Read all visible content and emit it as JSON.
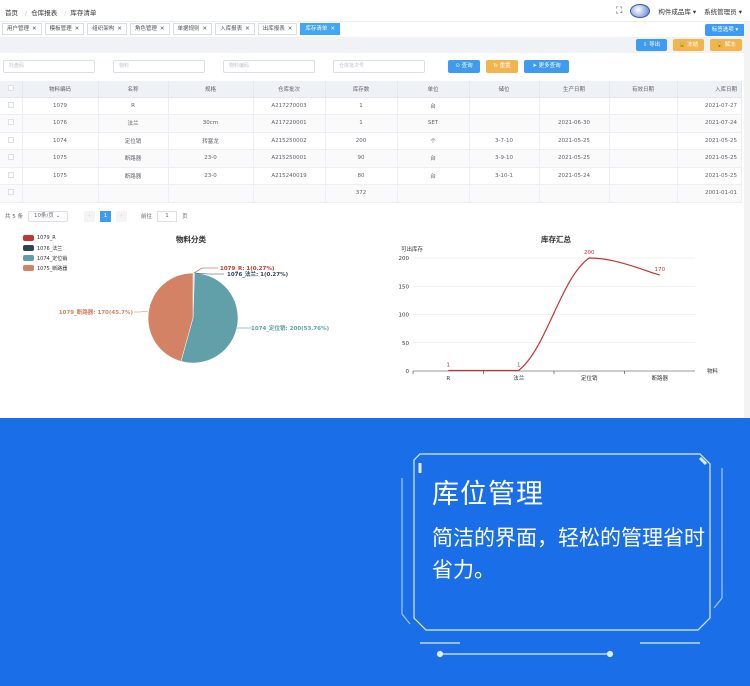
{
  "breadcrumb": [
    "首页",
    "仓库报表",
    "库存清单"
  ],
  "header": {
    "company": "构件成品库 ▾",
    "user": "系统管理员 ▾"
  },
  "tabs": [
    {
      "label": "用户管理"
    },
    {
      "label": "模板管理"
    },
    {
      "label": "组织架构"
    },
    {
      "label": "角色管理"
    },
    {
      "label": "单据规则"
    },
    {
      "label": "入库报表"
    },
    {
      "label": "出库报表"
    },
    {
      "label": "库存清单"
    }
  ],
  "actions": {
    "switch_label": "标签选项 ▾",
    "export_label": "导出",
    "freeze_label": "冻结",
    "unfreeze_label": "解冻"
  },
  "filters": {
    "p1": "托盘码",
    "p2": "物料",
    "p3": "物料编码",
    "p4": "仓库批次号"
  },
  "filter_buttons": {
    "search": "查询",
    "reset": "重置",
    "more": "更多查询"
  },
  "table": {
    "columns": [
      "物料编码",
      "名称",
      "规格",
      "仓库批次",
      "库存数",
      "单位",
      "储位",
      "生产日期",
      "有效日期",
      "入库日期"
    ],
    "rows": [
      [
        "1079",
        "R",
        "",
        "A217270003",
        "1",
        "台",
        "",
        "",
        "",
        "2021-07-27"
      ],
      [
        "1076",
        "法兰",
        "30cm",
        "A217220001",
        "1",
        "SET",
        "",
        "2021-06-30",
        "",
        "2021-07-24"
      ],
      [
        "1074",
        "定位销",
        "转塞龙",
        "A215250002",
        "200",
        "个",
        "3-7-10",
        "2021-05-25",
        "",
        "2021-05-25"
      ],
      [
        "1075",
        "断路器",
        "23-0",
        "A215250001",
        "90",
        "台",
        "3-9-10",
        "2021-05-25",
        "",
        "2021-05-25"
      ],
      [
        "1075",
        "断路器",
        "23-0",
        "A215240019",
        "80",
        "台",
        "3-10-1",
        "2021-05-24",
        "",
        "2021-05-25"
      ],
      [
        "",
        "",
        "",
        "",
        "372",
        "",
        "",
        "",
        "",
        "2001-01-01"
      ]
    ]
  },
  "pagination": {
    "total": "共 5 条",
    "size": "10条/页 ⌄",
    "prev": "‹",
    "page": "1",
    "next": "›",
    "goto": "前往",
    "goto_val": "1",
    "unit": "页"
  },
  "pie": {
    "title": "物料分类",
    "legend": [
      "1079_R",
      "1076_法兰",
      "1074_定位销",
      "1075_断路器"
    ],
    "colors": [
      "#c23531",
      "#2f4554",
      "#61a0a8",
      "#d48265"
    ],
    "labels": [
      "1079_R: 1(0.27%)",
      "1076_法兰: 1(0.27%)",
      "1074_定位销: 200(53.76%)",
      "1079_断路器: 170(45.7%)"
    ]
  },
  "chart_data": [
    {
      "type": "pie",
      "title": "物料分类",
      "categories": [
        "1079_R",
        "1076_法兰",
        "1074_定位销",
        "1075_断路器"
      ],
      "values": [
        1,
        1,
        200,
        170
      ]
    },
    {
      "type": "line",
      "title": "库存汇总",
      "ylabel": "可出库存",
      "xlabel": "物料",
      "categories": [
        "R",
        "法兰",
        "定位销",
        "断路器"
      ],
      "values": [
        1,
        1,
        200,
        170
      ],
      "ylim": [
        0,
        200
      ],
      "yticks": [
        0,
        50,
        100,
        150,
        200
      ],
      "line_color": "#c23531",
      "smooth": true
    }
  ],
  "feature": {
    "title": "库位管理",
    "desc": "简洁的界面，轻松的管理省时省力。"
  }
}
